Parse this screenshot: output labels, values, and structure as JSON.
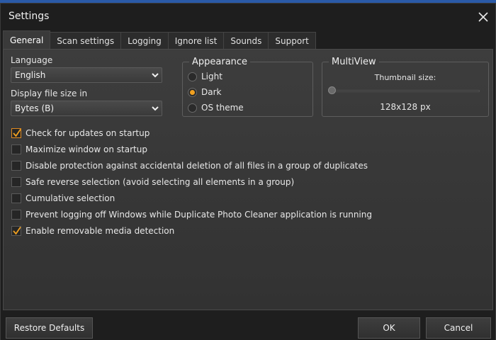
{
  "window": {
    "title": "Settings"
  },
  "tabs": [
    {
      "label": "General",
      "active": true
    },
    {
      "label": "Scan settings",
      "active": false
    },
    {
      "label": "Logging",
      "active": false
    },
    {
      "label": "Ignore list",
      "active": false
    },
    {
      "label": "Sounds",
      "active": false
    },
    {
      "label": "Support",
      "active": false
    }
  ],
  "general": {
    "language_label": "Language",
    "language_value": "English",
    "file_size_label": "Display file size in",
    "file_size_value": "Bytes (B)",
    "appearance": {
      "title": "Appearance",
      "options": [
        {
          "label": "Light",
          "selected": false
        },
        {
          "label": "Dark",
          "selected": true
        },
        {
          "label": "OS theme",
          "selected": false
        }
      ]
    },
    "multiview": {
      "title": "MultiView",
      "thumbnail_label": "Thumbnail size:",
      "thumbnail_value": "128x128 px",
      "slider_fraction": 0.0
    },
    "checkboxes": [
      {
        "label": "Check for updates on startup",
        "checked": true
      },
      {
        "label": "Maximize window on startup",
        "checked": false
      },
      {
        "label": "Disable protection against accidental deletion of all files in a group of duplicates",
        "checked": false
      },
      {
        "label": "Safe reverse selection (avoid selecting all elements in a group)",
        "checked": false
      },
      {
        "label": "Cumulative selection",
        "checked": false
      },
      {
        "label": "Prevent logging off Windows while Duplicate Photo Cleaner application is running",
        "checked": false
      },
      {
        "label": "Enable removable media detection",
        "checked": true
      }
    ]
  },
  "footer": {
    "restore_label": "Restore Defaults",
    "ok_label": "OK",
    "cancel_label": "Cancel"
  },
  "colors": {
    "accent": "#f0a020",
    "background": "#1e1e1e",
    "panel": "#3a3a3a"
  }
}
